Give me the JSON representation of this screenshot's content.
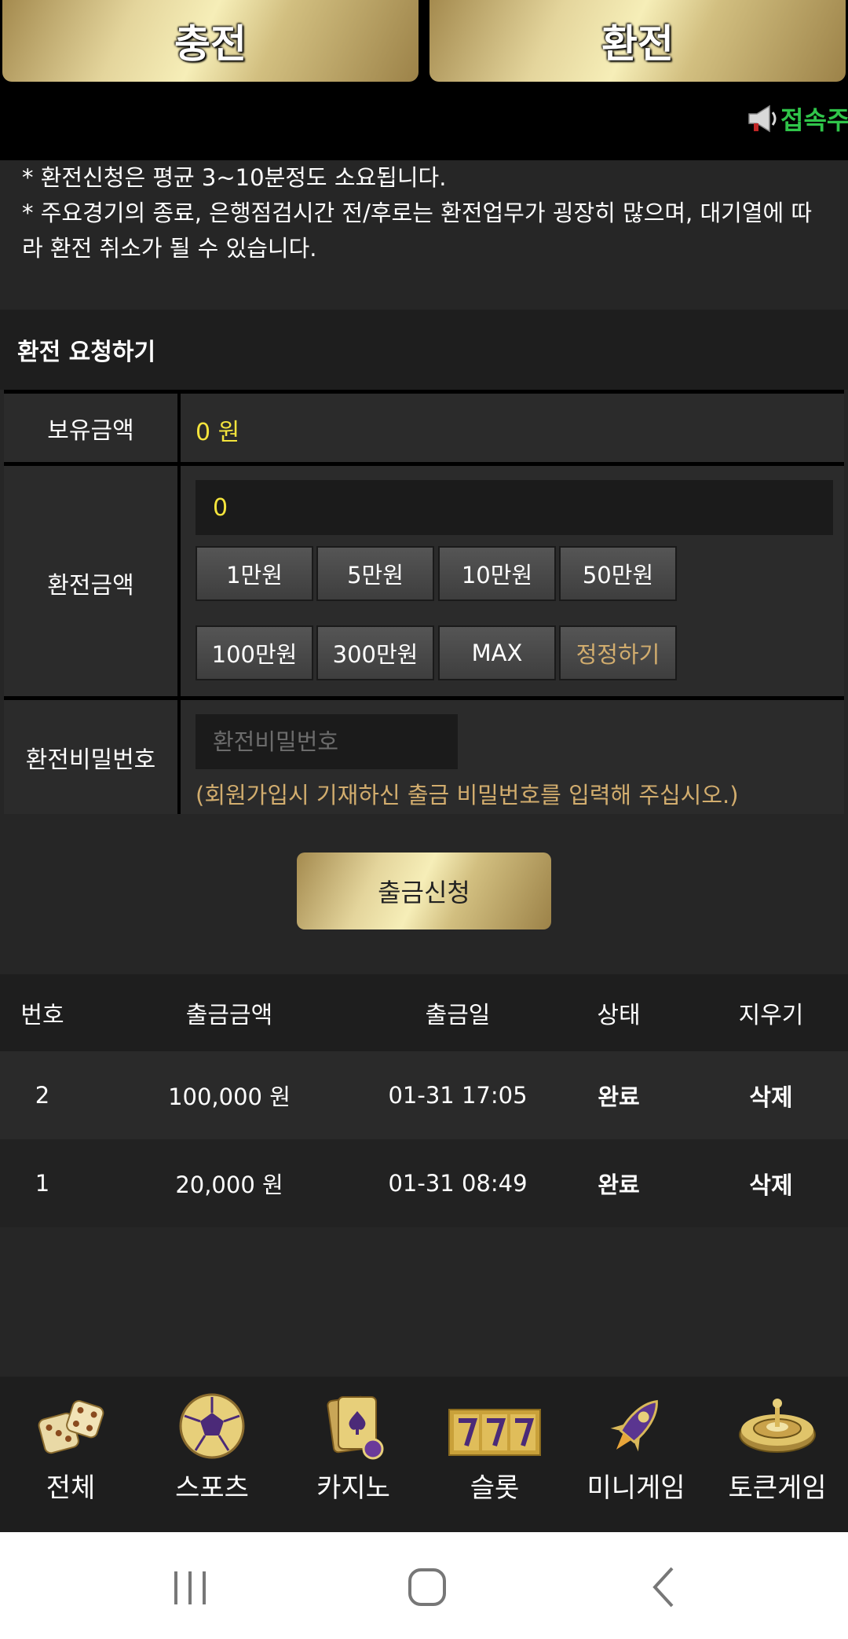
{
  "top_tabs": {
    "charge": "충전",
    "withdraw": "환전"
  },
  "marquee": {
    "text": "접속주",
    "icon": "megaphone-icon"
  },
  "notice": {
    "line1": "* 환전신청은 평균 3~10분정도 소요됩니다.",
    "line2": "* 주요경기의 종료, 은행점검시간 전/후로는 환전업무가 굉장히 많으며, 대기열에 따라 환전 취소가 될 수 있습니다."
  },
  "form": {
    "title": "환전 요청하기",
    "balance_label": "보유금액",
    "balance_value": "0 원",
    "amount_label": "환전금액",
    "amount_value": "0",
    "quick_buttons": [
      "1만원",
      "5만원",
      "10만원",
      "50만원",
      "100만원",
      "300만원",
      "MAX",
      "정정하기"
    ],
    "password_label": "환전비밀번호",
    "password_placeholder": "환전비밀번호",
    "password_hint": "(회원가입시 기재하신 출금 비밀번호를 입력해 주십시오.)",
    "submit_label": "출금신청"
  },
  "history": {
    "headers": [
      "번호",
      "출금금액",
      "출금일",
      "상태",
      "지우기"
    ],
    "rows": [
      {
        "no": "2",
        "amount": "100,000 원",
        "date": "01-31 17:05",
        "status": "완료",
        "action": "삭제"
      },
      {
        "no": "1",
        "amount": "20,000 원",
        "date": "01-31 08:49",
        "status": "완료",
        "action": "삭제"
      }
    ]
  },
  "bottom_nav": [
    {
      "label": "전체",
      "icon": "dice-icon"
    },
    {
      "label": "스포츠",
      "icon": "soccer-ball-icon"
    },
    {
      "label": "카지노",
      "icon": "playing-cards-icon"
    },
    {
      "label": "슬롯",
      "icon": "slot-777-icon"
    },
    {
      "label": "미니게임",
      "icon": "rocket-icon"
    },
    {
      "label": "토큰게임",
      "icon": "roulette-icon"
    }
  ],
  "system_nav": [
    "recent-apps-icon",
    "home-icon",
    "back-icon"
  ],
  "colors": {
    "accent_yellow": "#f4e43c",
    "hint_gold": "#d2ad6e",
    "marquee_green": "#30c54a",
    "background": "#262626"
  }
}
